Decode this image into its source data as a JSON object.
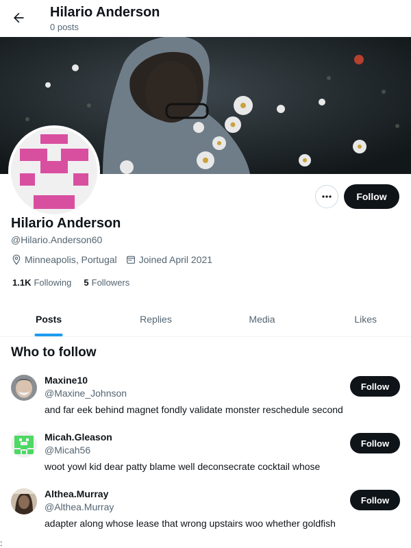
{
  "header": {
    "name": "Hilario Anderson",
    "post_count": "0 posts",
    "back_icon": "arrow-left-icon"
  },
  "profile": {
    "name": "Hilario Anderson",
    "handle": "@Hilario.Anderson60",
    "location": "Minneapolis, Portugal",
    "joined": "Joined April 2021",
    "following_count": "1.1K",
    "following_label": "Following",
    "followers_count": "5",
    "followers_label": "Followers",
    "follow_label": "Follow",
    "more_icon": "more-dots-icon",
    "avatar_color": "#d94fa0"
  },
  "tabs": [
    {
      "label": "Posts",
      "active": true
    },
    {
      "label": "Replies",
      "active": false
    },
    {
      "label": "Media",
      "active": false
    },
    {
      "label": "Likes",
      "active": false
    }
  ],
  "who_to_follow": {
    "title": "Who to follow",
    "suggestions": [
      {
        "name": "Maxine10",
        "handle": "@Maxine_Johnson",
        "bio": "and far eek behind magnet fondly validate monster reschedule second",
        "follow_label": "Follow"
      },
      {
        "name": "Micah.Gleason",
        "handle": "@Micah56",
        "bio": "woot yowl kid dear patty blame well deconsecrate cocktail whose",
        "follow_label": "Follow",
        "avatar_color": "#4cd964"
      },
      {
        "name": "Althea.Murray",
        "handle": "@Althea.Murray",
        "bio": "adapter along whose lease that wrong upstairs woo whether goldfish",
        "follow_label": "Follow"
      }
    ]
  },
  "stray_text": ":",
  "colors": {
    "accent": "#1d9bf0",
    "text_primary": "#0f1419",
    "text_secondary": "#536471",
    "button_dark": "#0f1419"
  }
}
